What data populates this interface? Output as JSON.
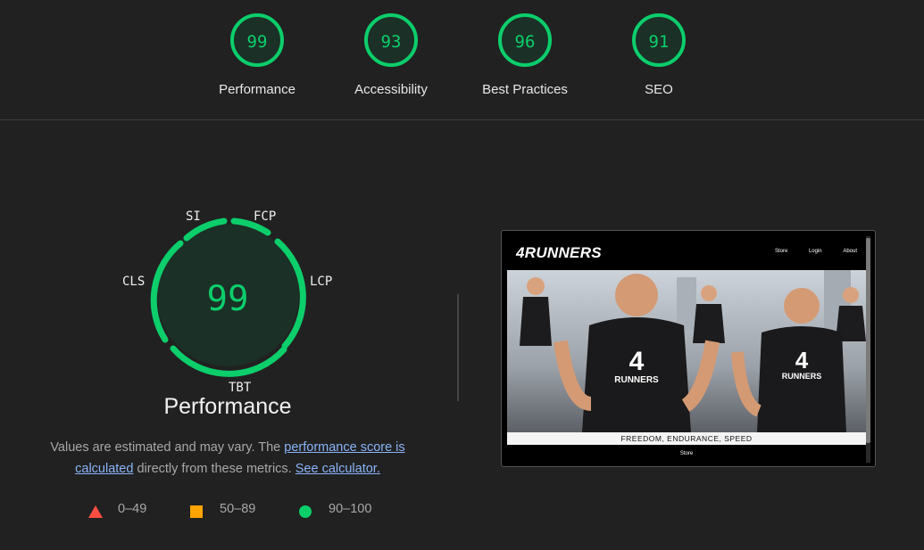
{
  "top_scores": [
    {
      "label": "Performance",
      "score": "99"
    },
    {
      "label": "Accessibility",
      "score": "93"
    },
    {
      "label": "Best Practices",
      "score": "96"
    },
    {
      "label": "SEO",
      "score": "91"
    }
  ],
  "performance": {
    "score": "99",
    "title": "Performance",
    "metric_labels": {
      "si": "SI",
      "fcp": "FCP",
      "lcp": "LCP",
      "cls": "CLS",
      "tbt": "TBT"
    },
    "desc_part1": "Values are estimated and may vary. The ",
    "desc_link1": "performance score is calculated",
    "desc_part2": " directly from these metrics. ",
    "desc_link2": "See calculator."
  },
  "legend": [
    {
      "range": "0–49",
      "shape": "triangle",
      "color": "#ff4e42"
    },
    {
      "range": "50–89",
      "shape": "square",
      "color": "#ffa400"
    },
    {
      "range": "90–100",
      "shape": "circle",
      "color": "#0cce6b"
    }
  ],
  "screenshot": {
    "logo": "4RUNNERS",
    "nav_links": [
      "Store",
      "Login",
      "About"
    ],
    "jersey_text": "4",
    "jersey_sub": "RUNNERS",
    "tagline": "FREEDOM, ENDURANCE, SPEED",
    "footer_link": "Store"
  },
  "colors": {
    "pass": "#0cce6b",
    "average": "#ffa400",
    "fail": "#ff4e42",
    "background": "#212121"
  }
}
